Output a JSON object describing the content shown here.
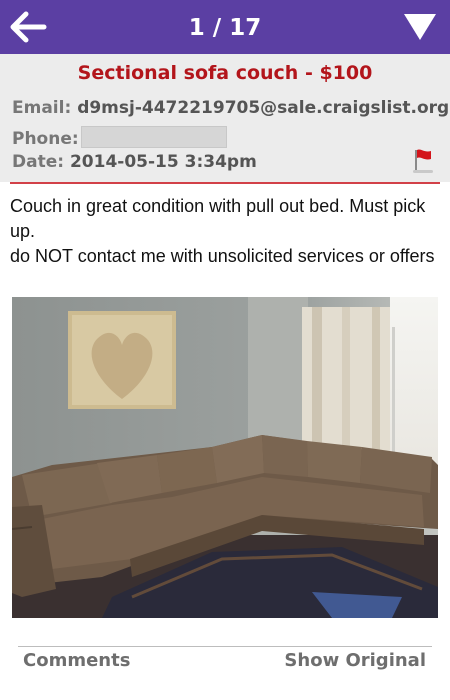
{
  "toolbar": {
    "pager": "1 / 17"
  },
  "listing": {
    "title": "Sectional sofa couch - $100",
    "email_label": "Email:",
    "email_value": "d9msj-4472219705@sale.craigslist.org",
    "phone_label": "Phone:",
    "date_label": "Date:",
    "date_value": "2014-05-15 3:34pm",
    "description_line1": "Couch in great condition with pull out bed. Must pick up.",
    "description_line2": "do NOT contact me with unsolicited services or offers"
  },
  "footer": {
    "comments_label": "Comments",
    "show_original_label": "Show Original"
  },
  "colors": {
    "topbar": "#5b3fa3",
    "title": "#b3151b",
    "rule": "#d24048"
  },
  "icons": {
    "back": "back-arrow-icon",
    "menu": "triangle-down-icon",
    "flag": "flag-icon"
  }
}
